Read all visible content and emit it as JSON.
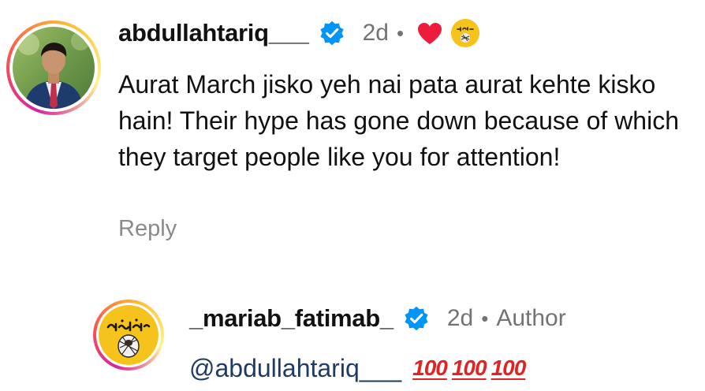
{
  "comment": {
    "username": "abdullahtariq___",
    "time": "2d",
    "separator": "•",
    "text": "Aurat March jisko yeh nai pata aurat kehte kisko hain! Their hype has gone down because of which they target people like you for attention!",
    "reply_label": "Reply",
    "liked_by_author": true
  },
  "reply": {
    "username": "_mariab_fatimab_",
    "time": "2d",
    "separator": "•",
    "author_label": "Author",
    "mention": "@abdullahtariq___",
    "emojis": [
      "💯",
      "💯",
      "💯"
    ]
  },
  "colors": {
    "text": "#111111",
    "meta": "#737373",
    "verified": "#0095f6",
    "heart": "#ed1c3c",
    "mention": "#1f3b63",
    "badge_yellow": "#f6c21c"
  },
  "icons": {
    "verified": "verified-badge-icon",
    "heart": "heart-icon",
    "author_badge": "author-avatar-icon"
  }
}
